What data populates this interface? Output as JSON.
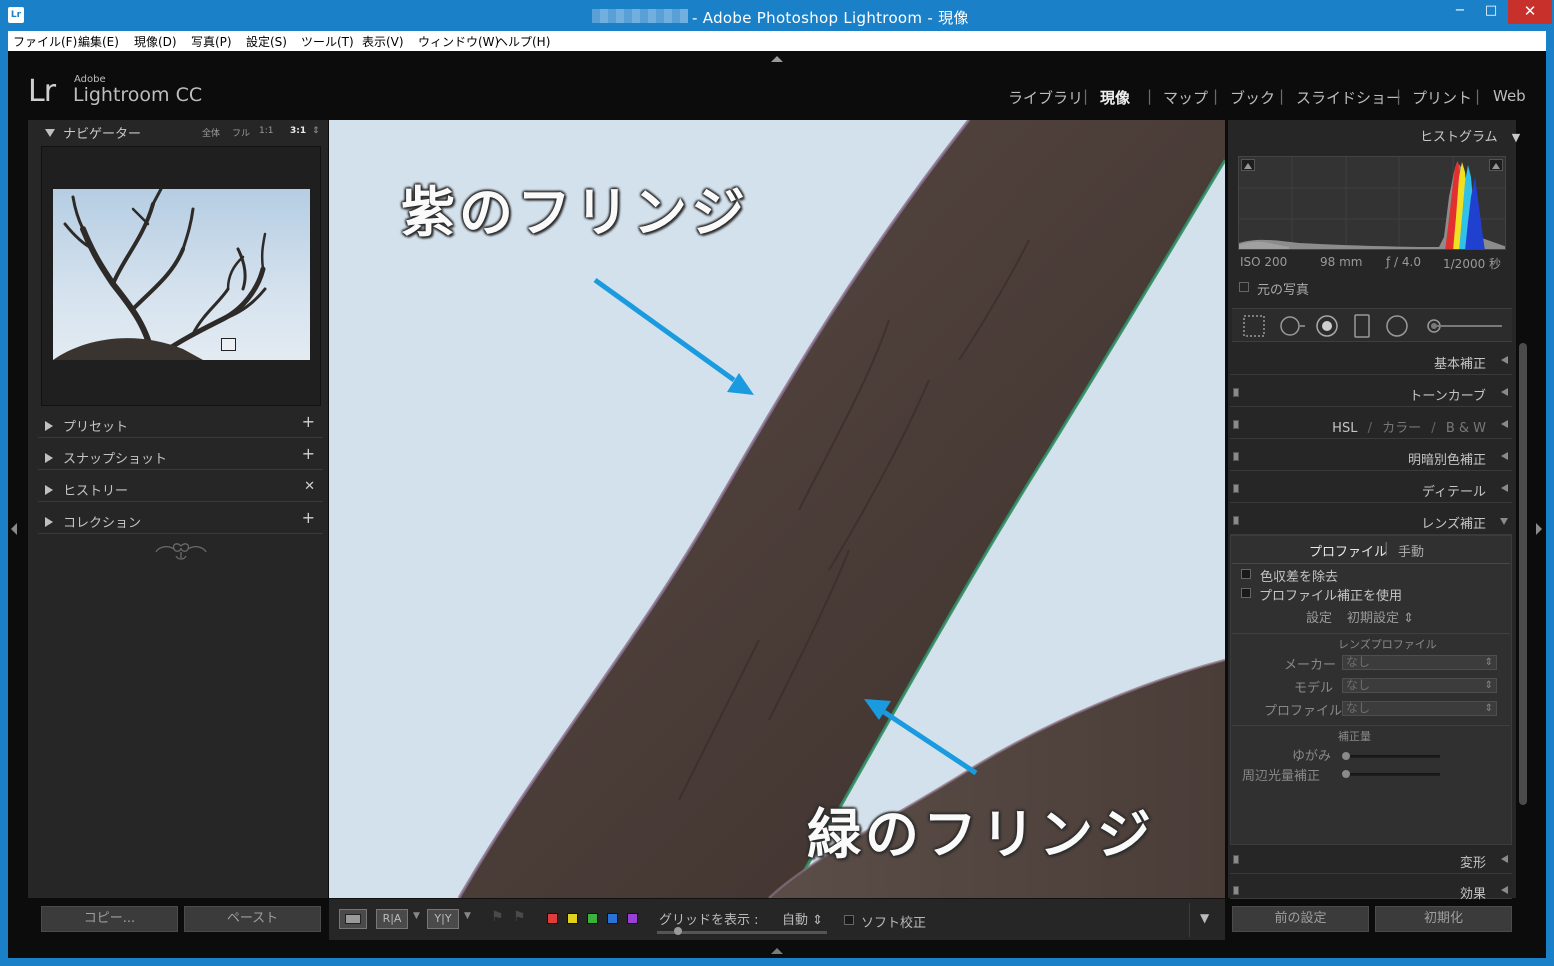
{
  "window": {
    "title": "- Adobe Photoshop Lightroom - 現像",
    "app_icon": "Lr",
    "minimize": "−",
    "maximize": "□",
    "close": "✕"
  },
  "menu": [
    "ファイル(F)",
    "編集(E)",
    "現像(D)",
    "写真(P)",
    "設定(S)",
    "ツール(T)",
    "表示(V)",
    "ウィンドウ(W)",
    "ヘルプ(H)"
  ],
  "logo": {
    "mark": "Lr",
    "vendor": "Adobe",
    "product": "Lightroom CC"
  },
  "modules": {
    "items": [
      "ライブラリ",
      "現像",
      "マップ",
      "ブック",
      "スライドショー",
      "プリント",
      "Web"
    ],
    "active": "現像",
    "separator": "|"
  },
  "left_panel": {
    "navigator": {
      "title": "ナビゲーター",
      "zoom_options": [
        "全体",
        "フル",
        "1:1",
        "3:1"
      ],
      "zoom_selected": "3:1",
      "zoom_arrow": "⇕"
    },
    "sections": [
      {
        "label": "プリセット",
        "action": "+"
      },
      {
        "label": "スナップショット",
        "action": "+"
      },
      {
        "label": "ヒストリー",
        "action": "✕"
      },
      {
        "label": "コレクション",
        "action": "+"
      }
    ],
    "buttons": {
      "copy": "コピー...",
      "paste": "ペースト"
    }
  },
  "annotations": {
    "purple": "紫のフリンジ",
    "green": "緑のフリンジ"
  },
  "toolbar": {
    "view_labels": [
      "R|A",
      "Y|Y"
    ],
    "grid_label": "グリッドを表示 :",
    "grid_value": "自動 ⇕",
    "soft_proof": "ソフト校正",
    "color_labels": [
      "#e23b3b",
      "#e0d21c",
      "#3bb23b",
      "#2a73d6",
      "#9a3fd6"
    ]
  },
  "right_panel": {
    "histogram": {
      "title": "ヒストグラム",
      "iso": "ISO 200",
      "focal": "98 mm",
      "aperture": "ƒ / 4.0",
      "shutter": "1/2000 秒",
      "original": "元の写真"
    },
    "sections": {
      "basic": "基本補正",
      "tone_curve": "トーンカーブ",
      "hsl_1": "HSL",
      "hsl_sep": "/",
      "hsl_2": "カラー",
      "hsl_3": "B & W",
      "split_toning": "明暗別色補正",
      "detail": "ディテール",
      "lens": "レンズ補正",
      "transform": "変形",
      "effects": "効果"
    },
    "lens": {
      "tab_profile": "プロファイル",
      "tab_manual": "手動",
      "tab_sep": "|",
      "remove_ca": "色収差を除去",
      "enable_profile": "プロファイル補正を使用",
      "setup_label": "設定",
      "setup_value": "初期設定 ⇕",
      "profile_header": "レンズプロファイル",
      "maker_label": "メーカー",
      "maker_value": "なし",
      "model_label": "モデル",
      "model_value": "なし",
      "profile_label": "プロファイル",
      "profile_value": "なし",
      "amount_header": "補正量",
      "distortion": "ゆがみ",
      "vignetting": "周辺光量補正"
    },
    "buttons": {
      "previous": "前の設定",
      "reset": "初期化"
    }
  }
}
